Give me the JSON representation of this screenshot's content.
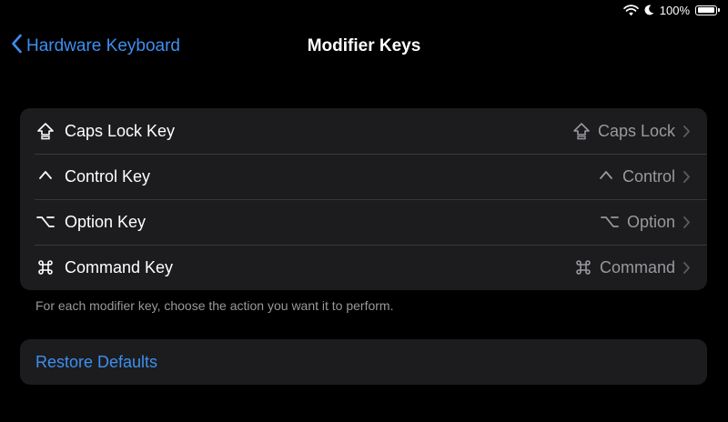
{
  "status_bar": {
    "battery_text": "100%",
    "battery_level": 1.0,
    "icons": [
      "wifi-icon",
      "moon-icon",
      "battery-icon"
    ]
  },
  "nav": {
    "back_label": "Hardware Keyboard",
    "title": "Modifier Keys"
  },
  "modifier_keys": [
    {
      "label": "Caps Lock Key",
      "value": "Caps Lock",
      "icon": "caps-lock-icon"
    },
    {
      "label": "Control Key",
      "value": "Control",
      "icon": "control-icon"
    },
    {
      "label": "Option Key",
      "value": "Option",
      "icon": "option-icon"
    },
    {
      "label": "Command Key",
      "value": "Command",
      "icon": "command-icon"
    }
  ],
  "footnote": "For each modifier key, choose the action you want it to perform.",
  "restore_label": "Restore Defaults",
  "colors": {
    "background": "#000000",
    "cell": "#1c1c1e",
    "separator": "#38383a",
    "accent": "#3d8ff0",
    "secondary_text": "#98989e"
  }
}
